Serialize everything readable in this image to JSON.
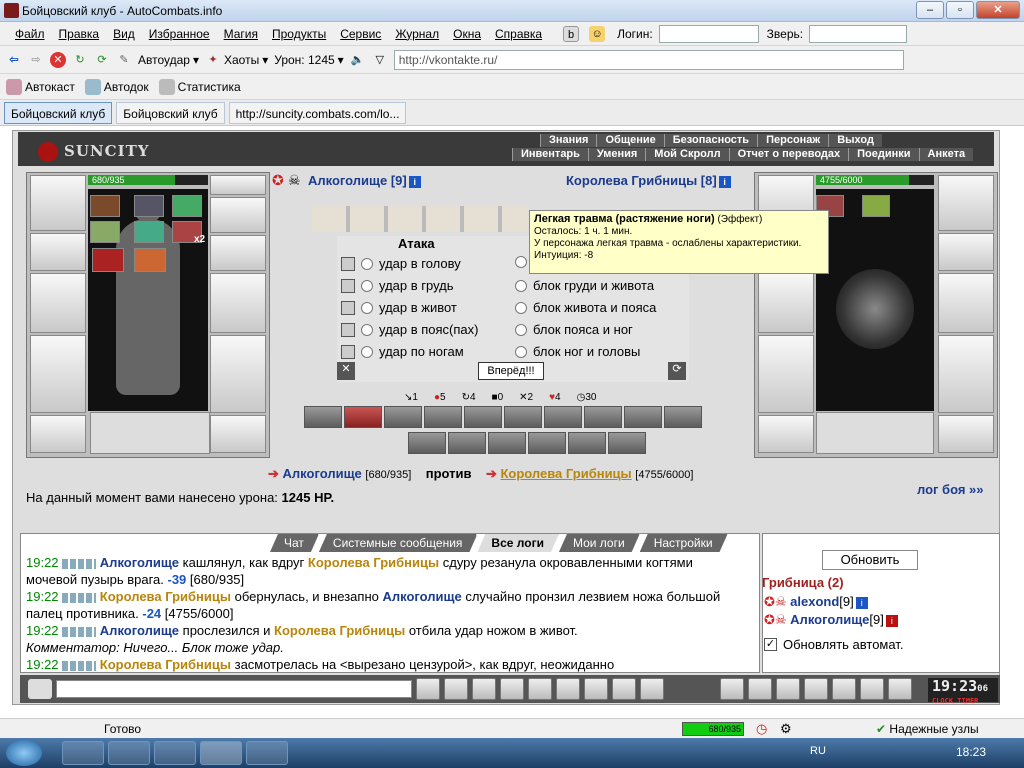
{
  "window": {
    "title": "Бойцовский клуб - AutoCombats.info"
  },
  "menu": [
    "Файл",
    "Правка",
    "Вид",
    "Избранное",
    "Магия",
    "Продукты",
    "Сервис",
    "Журнал",
    "Окна",
    "Справка"
  ],
  "menu_right": {
    "login_label": "Логин:",
    "beast_label": "Зверь:"
  },
  "toolbar": {
    "autohit": "Автоудар",
    "chaos": "Хаоты",
    "damage": "Урон: 1245",
    "url": "http://vkontakte.ru/"
  },
  "toolbar3": {
    "autocast": "Автокаст",
    "autodoc": "Автодок",
    "stats": "Статистика"
  },
  "tabs": [
    "Бойцовский клуб",
    "Бойцовский клуб",
    "http://suncity.combats.com/lo..."
  ],
  "game": {
    "logo": "SUNCITY",
    "nav_top": [
      "Знания",
      "Общение",
      "Безопасность",
      "Персонаж",
      "Выход"
    ],
    "nav_bottom": [
      "Инвентарь",
      "Умения",
      "Мой Скролл",
      "Отчет о переводах",
      "Поединки",
      "Анкета"
    ],
    "player": {
      "name": "Алкоголище [9]",
      "hp": "680/935",
      "hp_frac": 0.727
    },
    "enemy": {
      "name": "Королева Грибницы [8]",
      "hp": "4755/6000",
      "hp_frac": 0.79
    },
    "rune_count": "x2",
    "tooltip": {
      "title": "Легкая травма (растяжение ноги)",
      "kind": "(Эффект)",
      "lines": [
        "Осталось: 1 ч. 1 мин.",
        "У персонажа легкая травма - ослаблены характеристики.",
        "Интуиция: -8"
      ]
    },
    "attack_title": "Атака",
    "attacks": [
      "удар в голову",
      "удар в грудь",
      "удар в живот",
      "удар в пояс(пах)",
      "удар по ногам"
    ],
    "blocks": [
      "блок груди и живота",
      "блок живота и пояса",
      "блок пояса и ног",
      "блок ног и головы"
    ],
    "forward_btn": "Вперёд!!!",
    "stats": [
      "1",
      "5",
      "4",
      "0",
      "2",
      "4",
      "30"
    ],
    "vs": {
      "player": "Алкоголище",
      "player_hp": "[680/935]",
      "word": "против",
      "enemy": "Королева Грибницы",
      "enemy_hp": "[4755/6000]"
    },
    "damage_text": "На данный момент вами нанесено урона:",
    "damage_value": "1245 HP.",
    "log_link": "лог боя »»"
  },
  "chat": {
    "tabs": [
      "Чат",
      "Системные сообщения",
      "Все логи",
      "Мои логи",
      "Настройки"
    ],
    "log": [
      {
        "time": "19:22",
        "actor": "Алкоголище",
        "t1": "кашлянул, как вдруг",
        "target": "Королева Грибницы",
        "t2": "сдуру резанула окровавленными когтями мочевой пузырь врага.",
        "dmg": "-39",
        "hp": "[680/935]",
        "actor_is_player": true
      },
      {
        "time": "19:22",
        "actor": "Королева Грибницы",
        "t1": "обернулась, и внезапно",
        "target": "Алкоголище",
        "t2": "случайно пронзил лезвием ножа большой палец противника.",
        "dmg": "-24",
        "hp": "[4755/6000]",
        "actor_is_player": false
      },
      {
        "time": "19:22",
        "actor": "Алкоголище",
        "t1": "прослезился и",
        "target": "Королева Грибницы",
        "t2": "отбила удар ножом в живот.",
        "dmg": "",
        "hp": "",
        "actor_is_player": true
      },
      {
        "time": "19:22",
        "actor": "Королева Грибницы",
        "t1": "засмотрелась на <вырезано цензурой>, как вдруг, неожиданно",
        "target": "",
        "t2": "",
        "dmg": "",
        "hp": "",
        "actor_is_player": false
      }
    ],
    "comment": "Комментатор: Ничего... Блок тоже удар."
  },
  "sidepanel": {
    "refresh": "Обновить",
    "room": "Грибница (2)",
    "users": [
      {
        "name": "alexond",
        "level": "[9]"
      },
      {
        "name": "Алкоголище",
        "level": "[9]"
      }
    ],
    "auto_refresh": "Обновлять автомат."
  },
  "clock": {
    "time": "19:23",
    "sec": "06",
    "label1": "CLOCK",
    "label2": "TIMER"
  },
  "statusbar": {
    "ready": "Готово",
    "hp": "680/935",
    "secure": "Надежные узлы"
  },
  "taskbar": {
    "lang": "RU",
    "time": "18:23"
  }
}
